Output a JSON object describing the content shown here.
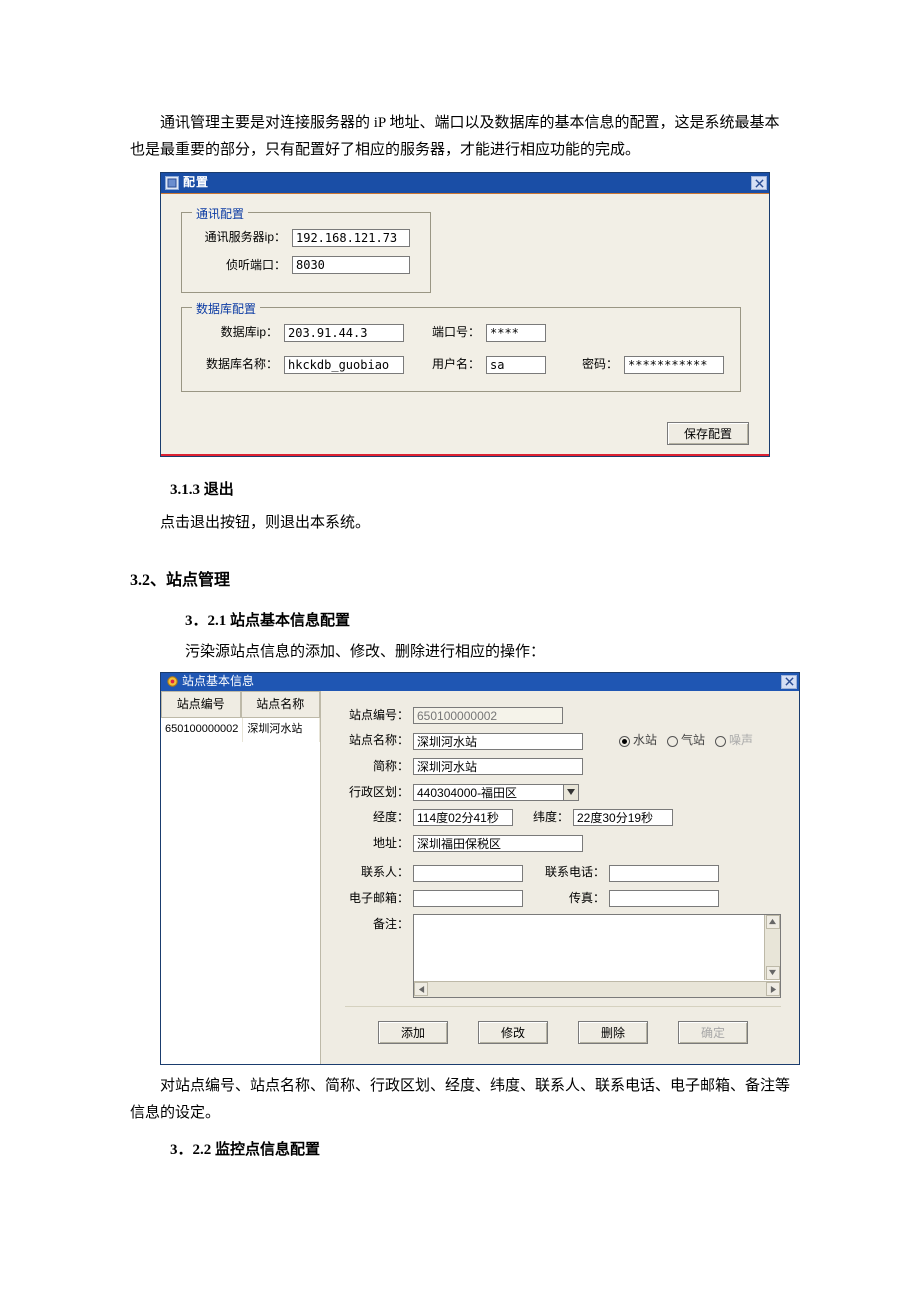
{
  "doc": {
    "intro": "通讯管理主要是对连接服务器的 iP 地址、端口以及数据库的基本信息的配置，这是系统最基本也是最重要的部分，只有配置好了相应的服务器，才能进行相应功能的完成。",
    "h313": "3.1.3 退出",
    "p313": "点击退出按钮，则退出本系统。",
    "h32": "3.2、站点管理",
    "h321": "3．2.1  站点基本信息配置",
    "p321": "污染源站点信息的添加、修改、删除进行相应的操作：",
    "p_after": "对站点编号、站点名称、简称、行政区划、经度、纬度、联系人、联系电话、电子邮箱、备注等信息的设定。",
    "h322": "3．2.2  监控点信息配置"
  },
  "cfg": {
    "title": "配置",
    "grp_comm": "通讯配置",
    "lbl_server_ip": "通讯服务器ip：",
    "val_server_ip": "192.168.121.73",
    "lbl_listen_port": "侦听端口：",
    "val_listen_port": "8030",
    "grp_db": "数据库配置",
    "lbl_db_ip": "数据库ip：",
    "val_db_ip": "203.91.44.3",
    "lbl_port": "端口号：",
    "val_port": "****",
    "lbl_db_name": "数据库名称：",
    "val_db_name": "hkckdb_guobiao",
    "lbl_user": "用户名：",
    "val_user": "sa",
    "lbl_pwd": "密码：",
    "val_pwd": "***********",
    "btn_save": "保存配置"
  },
  "site": {
    "title": "站点基本信息",
    "list_header_id": "站点编号",
    "list_header_name": "站点名称",
    "row1_id": "650100000002",
    "row1_name": "深圳河水站",
    "lbl_siteid": "站点编号：",
    "val_siteid": "650100000002",
    "lbl_sitename": "站点名称：",
    "val_sitename": "深圳河水站",
    "lbl_short": "简称：",
    "val_short": "深圳河水站",
    "lbl_region": "行政区划：",
    "val_region": "440304000-福田区",
    "lbl_lon": "经度：",
    "val_lon": "114度02分41秒",
    "lbl_lat": "纬度：",
    "val_lat": "22度30分19秒",
    "lbl_addr": "地址：",
    "val_addr": "深圳福田保税区",
    "lbl_contact": "联系人：",
    "val_contact": "",
    "lbl_phone": "联系电话：",
    "val_phone": "",
    "lbl_email": "电子邮箱：",
    "val_email": "",
    "lbl_fax": "传真：",
    "val_fax": "",
    "lbl_memo": "备注：",
    "val_memo": "",
    "radio_water": "水站",
    "radio_air": "气站",
    "radio_noise": "噪声",
    "btn_add": "添加",
    "btn_edit": "修改",
    "btn_del": "删除",
    "btn_ok": "确定"
  }
}
